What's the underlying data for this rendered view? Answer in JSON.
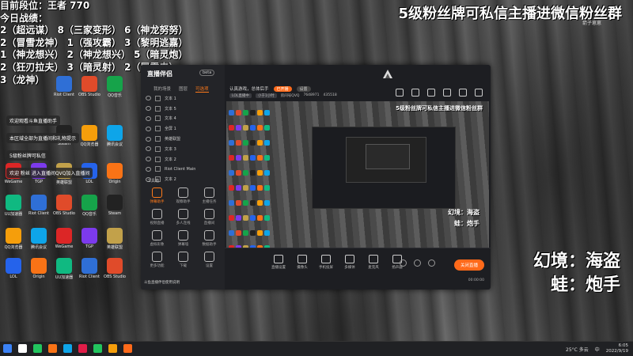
{
  "overlay": {
    "rank_lines": [
      "目前段位：王者 770",
      "今日战绩：",
      "2（超远谋）    8（三家变形）  6（神龙努努）",
      "2（冒雪龙神）  1（强攻霸）    3（黎明逃嘉）",
      "1（神龙想兴）  2（神龙想兴）  5（暗灵炮）",
      "2（狂刃拉夫）  3（暗灵射）    2（冒雪虫）",
      "3（龙神）"
    ],
    "top_banner": "5级粉丝牌可私信主播进微信粉丝群",
    "top_sub": "箭子崽崽",
    "big_lines": [
      "幻境：海盗",
      "蛙：炮手"
    ]
  },
  "desktop": {
    "notices": [
      "欢迎观看斗鱼直播助手",
      "本区域全部为直播间和礼物提示",
      "5级粉丝牌可私信",
      "欢迎 粉丝 进入直播间QVQ加入直播间"
    ],
    "icon_labels": [
      "Riot Client",
      "OBS Studio",
      "QQ音乐",
      "Steam",
      "QQ浏览器",
      "腾讯会议",
      "WeGame",
      "TGP",
      "英雄联盟",
      "LOL",
      "Origin",
      "UU加速器"
    ],
    "icon_colors": [
      "#2f6fd6",
      "#e04b2a",
      "#16a34a",
      "#222222",
      "#f59e0b",
      "#0ea5e9",
      "#dc2626",
      "#7c3aed",
      "#c2a14a",
      "#2563eb",
      "#f97316",
      "#10b981"
    ]
  },
  "app": {
    "logo": "直播伴侣",
    "version": "beta",
    "tabs": [
      "我的场景",
      "图层",
      "可选项"
    ],
    "active_tab_index": 2,
    "scenes": [
      "文本 1",
      "文本 5",
      "文本 4",
      "全屏 1",
      "英雄联盟",
      "文本 3",
      "文本 2",
      "Riot Client Main",
      "文本 2"
    ],
    "tools_title": "工具箱",
    "tools": [
      {
        "label": "弹幕助手",
        "active": true
      },
      {
        "label": "观察助手",
        "active": false
      },
      {
        "label": "主播任务",
        "active": false
      },
      {
        "label": "视频直播",
        "active": false
      },
      {
        "label": "多人连线",
        "active": false
      },
      {
        "label": "直播间",
        "active": false
      },
      {
        "label": "虚拟形象",
        "active": false
      },
      {
        "label": "弹幕墙",
        "active": false
      },
      {
        "label": "数据助手",
        "active": false
      },
      {
        "label": "更多功能",
        "active": false
      },
      {
        "label": "下载",
        "active": false
      },
      {
        "label": "设置",
        "active": false
      }
    ],
    "tip": "斗鱼直播伴侣使用说明",
    "room_title": "认真游戏，总体后手",
    "room_tag_live": "已开播",
    "room_tag_other": "设置",
    "room_meta": [
      "LOL直播中",
      "小于1小时",
      "房间号QVQ",
      "7648971",
      "435518"
    ],
    "preview_banner": "5级粉丝牌可私信主播进微信粉丝群",
    "preview_lines": [
      "幻境：海盗",
      "蛙：炮手"
    ],
    "bottom_buttons": [
      "直播设置",
      "摄像头",
      "手机投屏",
      "多媒体",
      "麦克风",
      "扬声器"
    ],
    "go_live": "关闭直播",
    "timer": "00:00:00",
    "bottom_left": "直播"
  },
  "taskbar": {
    "weather": "25°C 多云",
    "lang": "中",
    "time": "6:05",
    "date": "2022/9/19",
    "icon_colors": [
      "#3b82f6",
      "#ffffff",
      "#22c55e",
      "#f97316",
      "#0ea5e9",
      "#e11d48",
      "#22c55e",
      "#f59e0b",
      "#ff6a1a"
    ]
  }
}
